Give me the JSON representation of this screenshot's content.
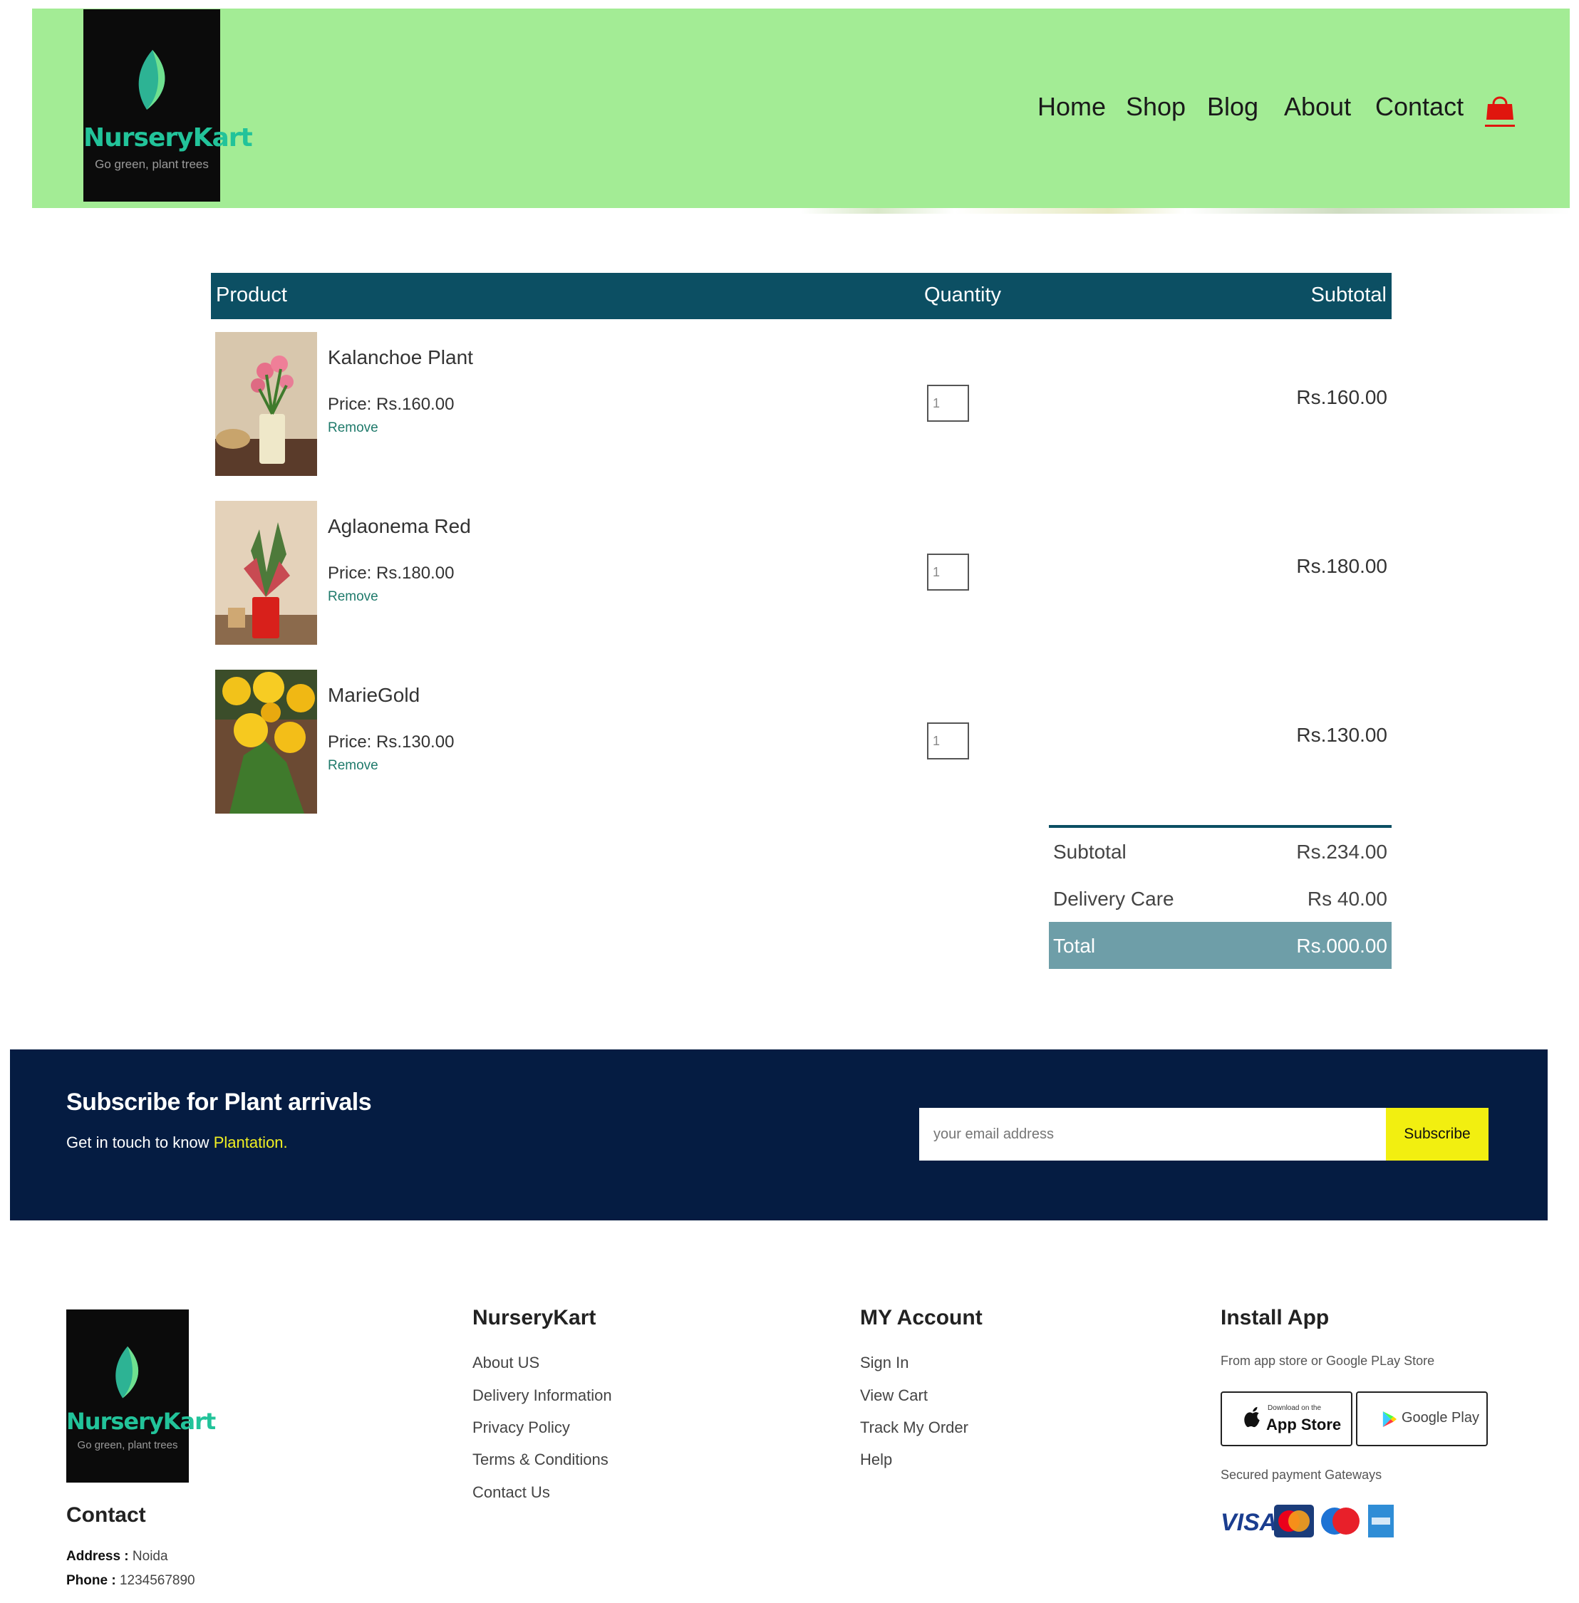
{
  "brand": {
    "name": "NurseryKart",
    "tagline": "Go green, plant trees"
  },
  "nav": {
    "items": [
      "Home",
      "Shop",
      "Blog",
      "About",
      "Contact"
    ]
  },
  "cart": {
    "headers": {
      "product": "Product",
      "quantity": "Quantity",
      "subtotal": "Subtotal"
    },
    "items": [
      {
        "name": "Kalanchoe Plant",
        "price": "Price: Rs.160.00",
        "remove": "Remove",
        "qty": "1",
        "subtotal": "Rs.160.00"
      },
      {
        "name": "Aglaonema Red",
        "price": "Price: Rs.180.00",
        "remove": "Remove",
        "qty": "1",
        "subtotal": "Rs.180.00"
      },
      {
        "name": "MarieGold",
        "price": "Price: Rs.130.00",
        "remove": "Remove",
        "qty": "1",
        "subtotal": "Rs.130.00"
      }
    ]
  },
  "totals": {
    "subtotal_label": "Subtotal",
    "subtotal_value": "Rs.234.00",
    "delivery_label": "Delivery Care",
    "delivery_value": "Rs 40.00",
    "total_label": "Total",
    "total_value": "Rs.000.00"
  },
  "subscribe": {
    "title": "Subscribe for Plant arrivals",
    "text": "Get in touch to know",
    "highlight": "Plantation.",
    "placeholder": "your email address",
    "button": "Subscribe"
  },
  "footer": {
    "contact": {
      "title": "Contact",
      "address_label": "Address :",
      "address": "Noida",
      "phone_label": "Phone :",
      "phone": "1234567890"
    },
    "col1": {
      "title": "NurseryKart",
      "links": [
        "About US",
        "Delivery Information",
        "Privacy Policy",
        "Terms & Conditions",
        "Contact Us"
      ]
    },
    "col2": {
      "title": "MY Account",
      "links": [
        "Sign In",
        "View Cart",
        "Track My Order",
        "Help"
      ]
    },
    "install": {
      "title": "Install App",
      "subtitle": "From app store or Google PLay Store",
      "appstore_small": "Download on the",
      "appstore": "App Store",
      "googleplay": "Google Play",
      "secured": "Secured payment Gateways",
      "visa": "VISA"
    }
  },
  "colors": {
    "header_bg": "#a3ec95",
    "table_head": "#0c4f63",
    "subscribe_bg": "#051c42",
    "accent_yellow": "#f2ef10",
    "total_bg": "#6e9ea8"
  }
}
